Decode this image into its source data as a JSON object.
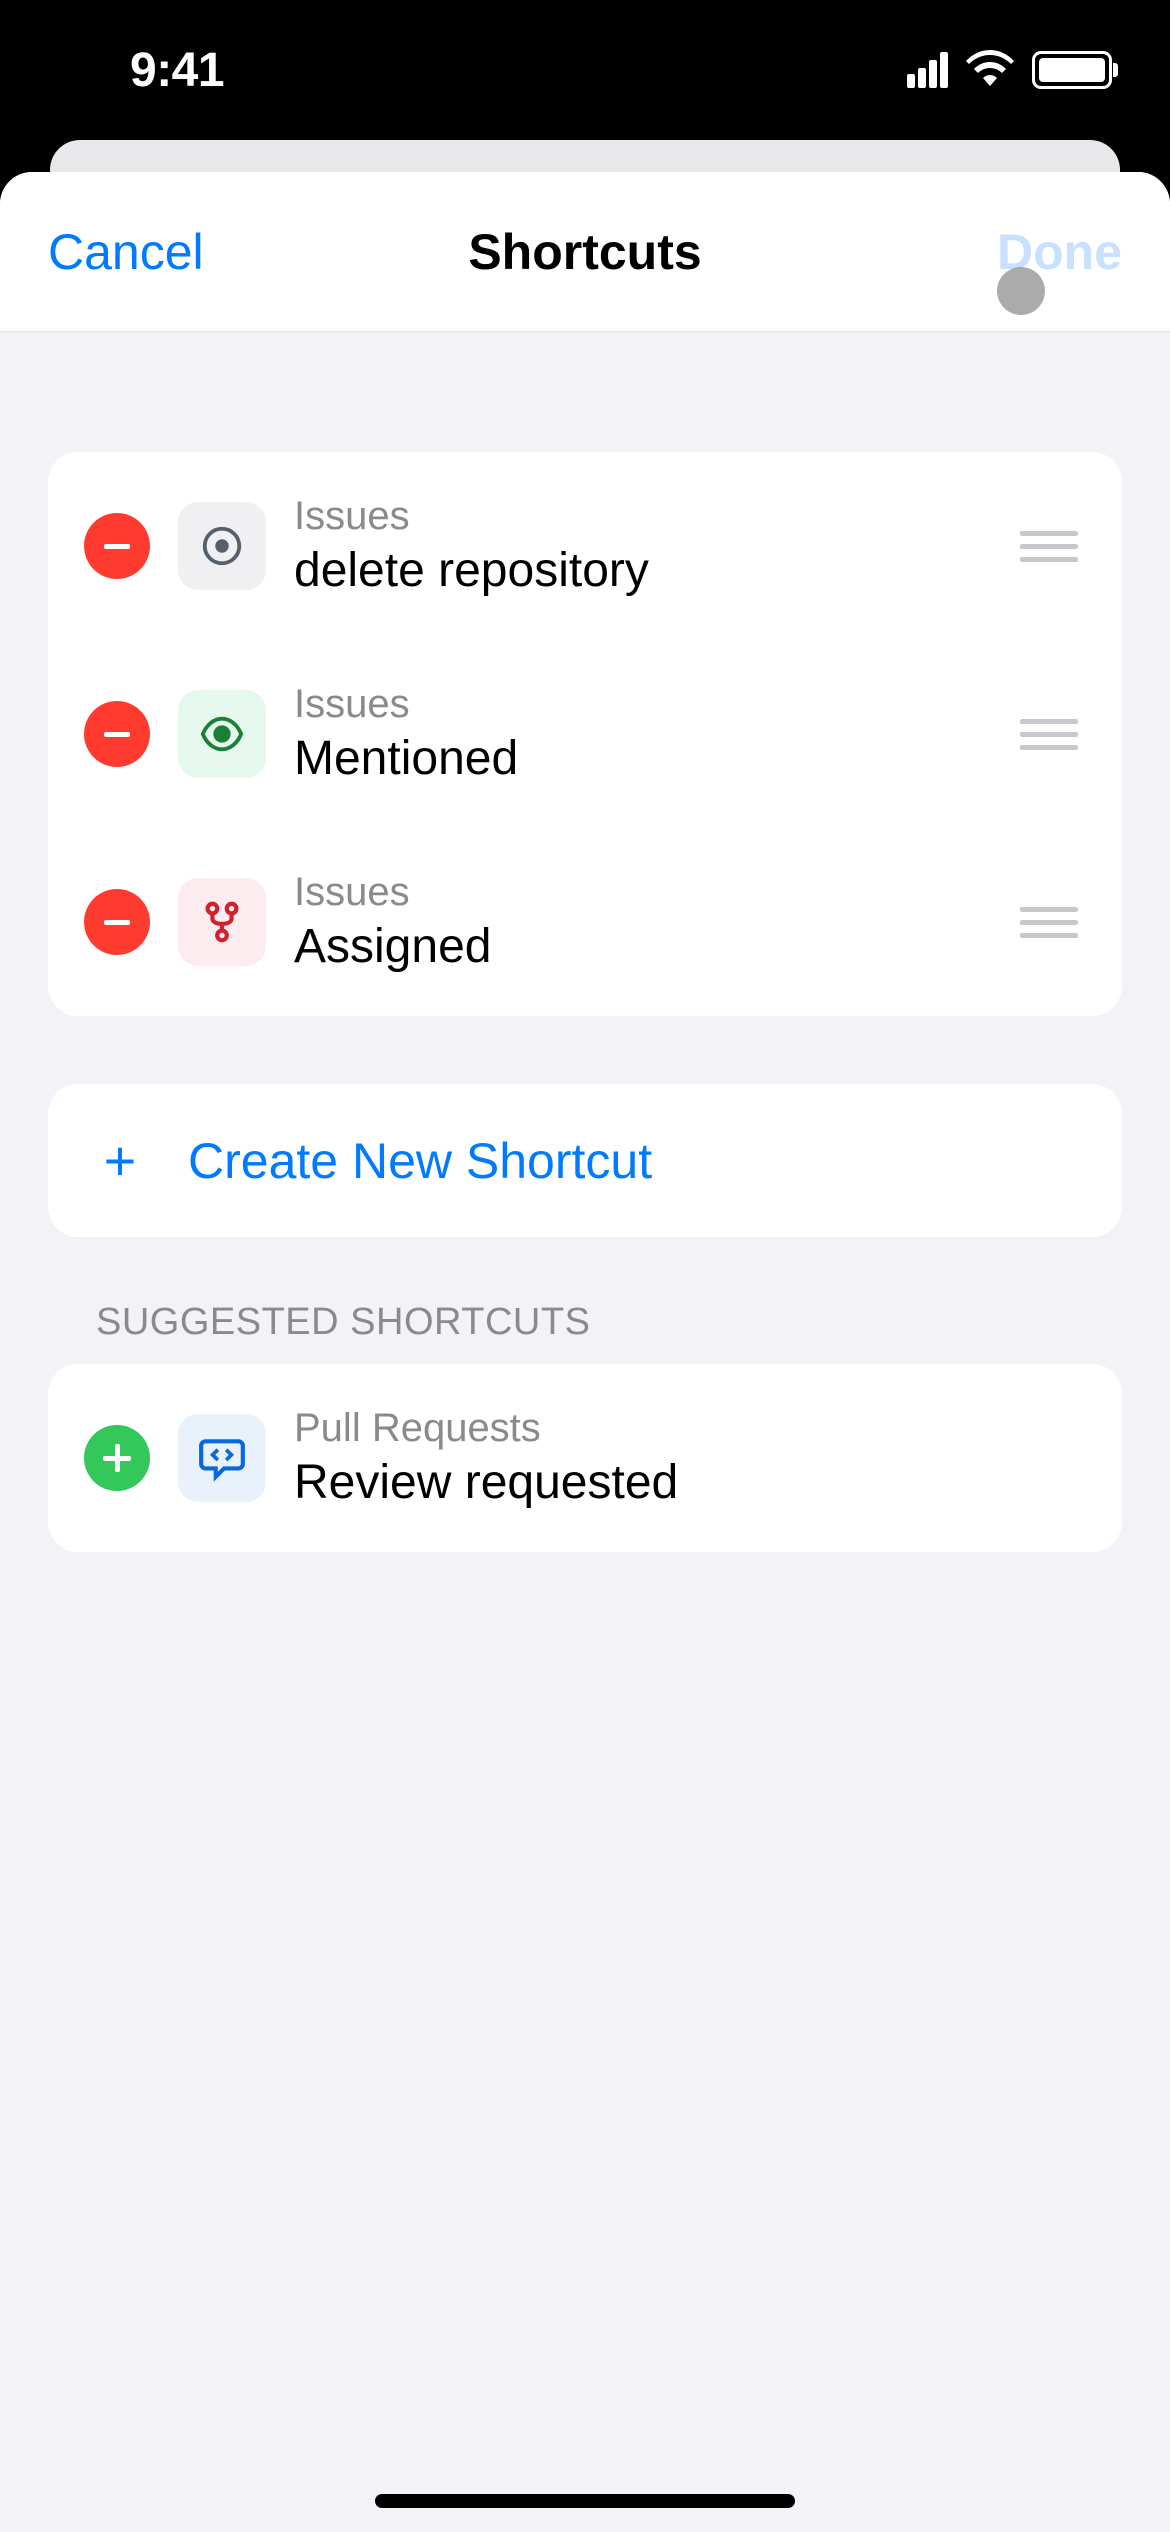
{
  "status": {
    "time": "9:41"
  },
  "header": {
    "cancel": "Cancel",
    "title": "Shortcuts",
    "done": "Done"
  },
  "shortcuts": [
    {
      "category": "Issues",
      "title": "delete repository",
      "icon": "issue-icon",
      "iconBg": "gray"
    },
    {
      "category": "Issues",
      "title": "Mentioned",
      "icon": "eye-icon",
      "iconBg": "green"
    },
    {
      "category": "Issues",
      "title": "Assigned",
      "icon": "fork-icon",
      "iconBg": "pink"
    }
  ],
  "createNew": {
    "label": "Create New Shortcut"
  },
  "suggested": {
    "header": "Suggested Shortcuts",
    "items": [
      {
        "category": "Pull Requests",
        "title": "Review requested",
        "icon": "code-review-icon",
        "iconBg": "blue"
      }
    ]
  }
}
